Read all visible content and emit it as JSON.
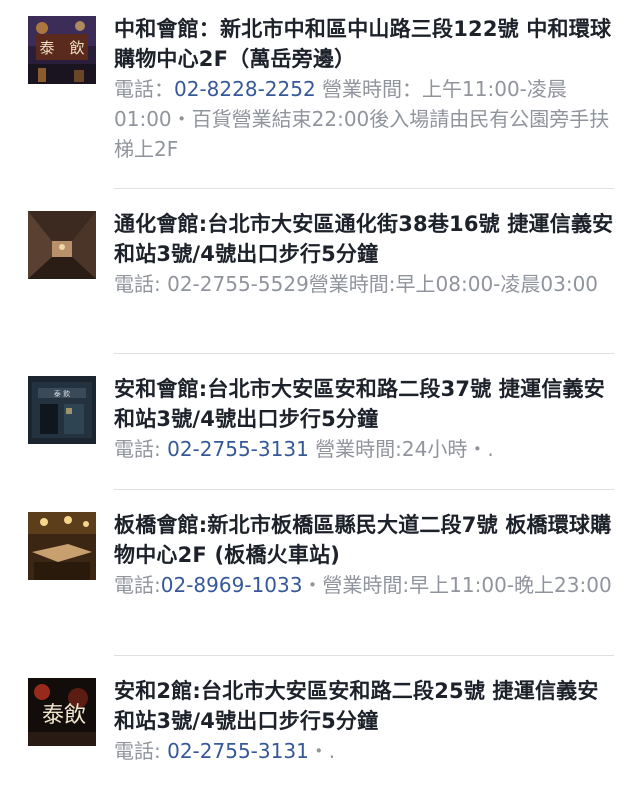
{
  "venues": [
    {
      "address": "中和會館：新北市中和區中山路三段122號 中和環球購物中心2F（萬岳旁邊）",
      "phone_label": "電話：",
      "phone": "02-8228-2252",
      "info": " 營業時間：上午11:00-凌晨01:00・百貨營業結束22:00後入場請由民有公園旁手扶梯上2F",
      "thumb_icon": "venue-photo-signboard"
    },
    {
      "address": "通化會館:台北市大安區通化街38巷16號 捷運信義安和站3號/4號出口步行5分鐘",
      "phone_label": "電話: ",
      "phone": "02-2755-5529",
      "info": "營業時間:早上08:00-凌晨03:00",
      "thumb_icon": "venue-photo-corridor"
    },
    {
      "address": "安和會館:台北市大安區安和路二段37號 捷運信義安和站3號/4號出口步行5分鐘",
      "phone_label": "電話: ",
      "phone": "02-2755-3131",
      "info": " 營業時間:24小時・.",
      "thumb_icon": "venue-photo-storefront"
    },
    {
      "address": "板橋會館:新北市板橋區縣民大道二段7號 板橋環球購物中心2F (板橋火車站)",
      "phone_label": "電話:",
      "phone": "02-8969-1033",
      "info": "・營業時間:早上11:00-晚上23:00",
      "thumb_icon": "venue-photo-lounge"
    },
    {
      "address": "安和2館:台北市大安區安和路二段25號 捷運信義安和站3號/4號出口步行5分鐘",
      "phone_label": "電話: ",
      "phone": "02-2755-3131",
      "info": "・.",
      "thumb_icon": "venue-photo-calligraphy"
    }
  ]
}
